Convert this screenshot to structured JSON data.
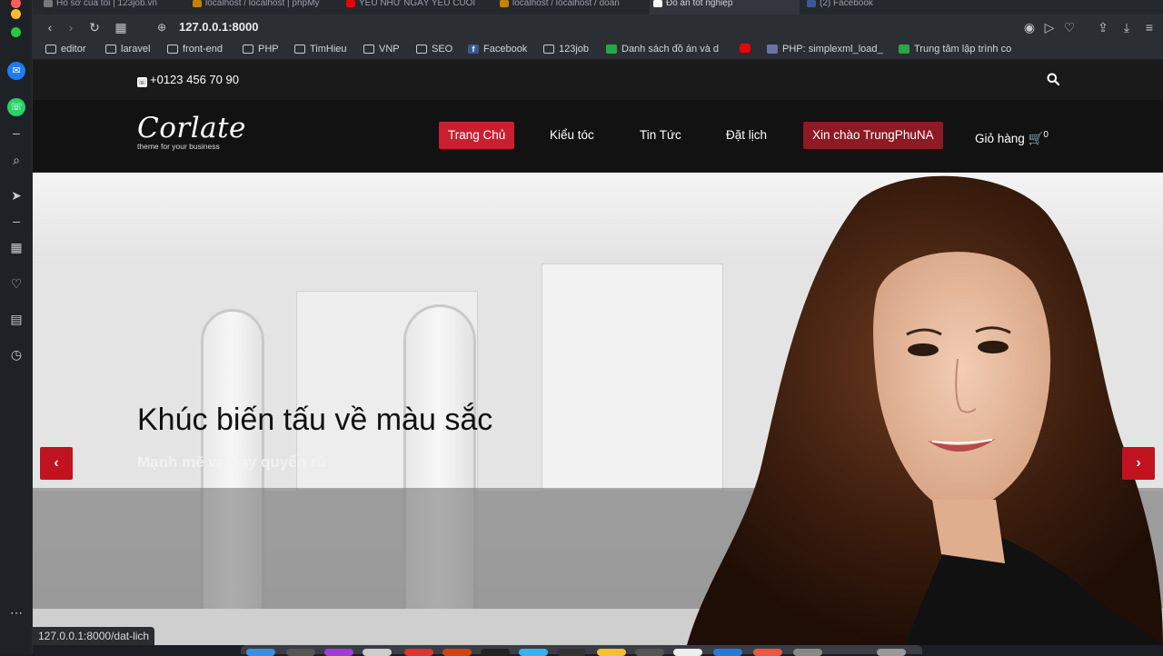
{
  "browser": {
    "tabs": [
      {
        "label": "Hồ sơ của tôi | 123job.vn"
      },
      {
        "label": "localhost / localhost | phpMy"
      },
      {
        "label": "YÊU NHƯ NGÀY YÊU CUỐI"
      },
      {
        "label": "localhost / localhost / doan"
      },
      {
        "label": "Đồ án tốt nghiệp"
      },
      {
        "label": "(2) Facebook"
      }
    ],
    "url": "127.0.0.1:8000",
    "bookmarks": [
      {
        "label": "editor",
        "icon": "folder-icon"
      },
      {
        "label": "laravel",
        "icon": "folder-icon"
      },
      {
        "label": "front-end",
        "icon": "folder-icon"
      },
      {
        "label": "PHP",
        "icon": "folder-icon"
      },
      {
        "label": "TimHieu",
        "icon": "folder-icon"
      },
      {
        "label": "VNP",
        "icon": "folder-icon"
      },
      {
        "label": "SEO",
        "icon": "folder-icon"
      },
      {
        "label": "Facebook",
        "icon": "facebook-icon"
      },
      {
        "label": "123job",
        "icon": "folder-icon"
      },
      {
        "label": "Danh sách đồ án và d",
        "icon": "sheets-icon"
      },
      {
        "label": "",
        "icon": "youtube-icon"
      },
      {
        "label": "PHP: simplexml_load_",
        "icon": "php-icon"
      },
      {
        "label": "Trung tâm lập trình co",
        "icon": "sheets-icon"
      }
    ],
    "status_url": "127.0.0.1:8000/dat-lich"
  },
  "site": {
    "phone": "+0123 456 70 90",
    "logo": {
      "word": "Corlate",
      "tagline": "theme for your business"
    },
    "nav": [
      {
        "label": "Trang Chủ",
        "state": "active"
      },
      {
        "label": "Kiểu tóc"
      },
      {
        "label": "Tin Tức"
      },
      {
        "label": "Đặt lịch"
      },
      {
        "label": "Xin chào TrungPhuNA",
        "state": "user"
      },
      {
        "label": "Giỏ hàng",
        "cart_count": "0"
      }
    ],
    "slider": {
      "title": "Khúc biến tấu về màu sắc",
      "subtitle": "Mạnh mẽ và đầy quyến rũ",
      "prev": "‹",
      "next": "›"
    }
  },
  "colors": {
    "accent_red": "#c91f30",
    "user_red": "#8d1a24",
    "topbar": "#1a1a1a"
  }
}
